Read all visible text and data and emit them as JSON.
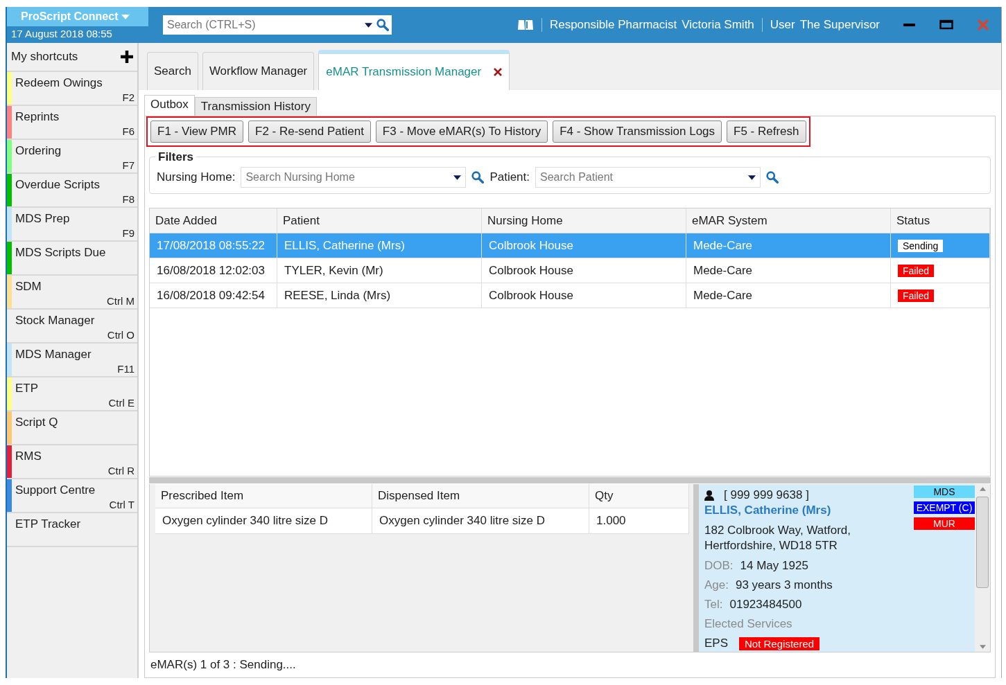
{
  "app": {
    "title": "ProScript Connect",
    "datetime": "17 August 2018 08:55",
    "search_placeholder": "Search (CTRL+S)",
    "pharmacist_label": "Responsible Pharmacist",
    "pharmacist": "Victoria Smith",
    "user_label": "User",
    "user": "The Supervisor"
  },
  "sidebar": {
    "title": "My shortcuts",
    "items": [
      {
        "label": "Redeem Owings",
        "shortcut": "F2",
        "color": "#ffff80"
      },
      {
        "label": "Reprints",
        "shortcut": "F6",
        "color": "#ff8080"
      },
      {
        "label": "Ordering",
        "shortcut": "F7",
        "color": "#80ff80"
      },
      {
        "label": "Overdue Scripts",
        "shortcut": "F8",
        "color": "#00c000"
      },
      {
        "label": "MDS Prep",
        "shortcut": "F9",
        "color": "#c0e4f8"
      },
      {
        "label": "MDS Scripts Due",
        "color": "#00c000"
      },
      {
        "label": "SDM",
        "shortcut": "Ctrl M",
        "color": "#ffe090"
      },
      {
        "label": "Stock Manager",
        "shortcut": "Ctrl O"
      },
      {
        "label": "MDS Manager",
        "shortcut": "F11",
        "color": "#c0e4f8"
      },
      {
        "label": "ETP",
        "shortcut": "Ctrl E",
        "color": "#ffff80"
      },
      {
        "label": "Script Q",
        "color": "#ffc870"
      },
      {
        "label": "RMS",
        "shortcut": "Ctrl R",
        "color": "#e0203c"
      },
      {
        "label": "Support Centre",
        "shortcut": "Ctrl T",
        "color": "#3a8ae0"
      },
      {
        "label": "ETP Tracker"
      }
    ]
  },
  "tabs": [
    {
      "label": "Search",
      "selected": false,
      "closable": false
    },
    {
      "label": "Workflow Manager",
      "selected": false,
      "closable": false
    },
    {
      "label": "eMAR Transmission Manager",
      "selected": true,
      "closable": true
    }
  ],
  "subtabs": [
    {
      "label": "Outbox",
      "selected": true
    },
    {
      "label": "Transmission History",
      "selected": false
    }
  ],
  "toolbar": [
    "F1 - View PMR",
    "F2 - Re-send Patient",
    "F3 - Move eMAR(s) To History",
    "F4 - Show Transmission Logs",
    "F5 - Refresh"
  ],
  "filters": {
    "title": "Filters",
    "nursing_home_label": "Nursing Home:",
    "nursing_home_placeholder": "Search Nursing Home",
    "patient_label": "Patient:",
    "patient_placeholder": "Search Patient"
  },
  "table": {
    "columns": [
      "Date Added",
      "Patient",
      "Nursing Home",
      "eMAR System",
      "Status"
    ],
    "rows": [
      {
        "date": "17/08/2018 08:55:22",
        "patient": "ELLIS, Catherine (Mrs)",
        "home": "Colbrook House",
        "system": "Mede-Care",
        "status": "Sending",
        "color": "#ffffff",
        "selected": true
      },
      {
        "date": "16/08/2018 12:02:03",
        "patient": "TYLER, Kevin (Mr)",
        "home": "Colbrook House",
        "system": "Mede-Care",
        "status": "Failed",
        "color": "#ff0000",
        "selected": false
      },
      {
        "date": "16/08/2018 09:42:54",
        "patient": "REESE, Linda (Mrs)",
        "home": "Colbrook House",
        "system": "Mede-Care",
        "status": "Failed",
        "color": "#ff0000",
        "selected": false
      }
    ]
  },
  "items_table": {
    "columns": [
      "Prescribed Item",
      "Dispensed Item",
      "Qty"
    ],
    "rows": [
      [
        "Oxygen cylinder 340 litre size D",
        "Oxygen cylinder 340 litre size D",
        "1.000"
      ]
    ]
  },
  "patient_card": {
    "nhs": "[ 999 999 9638 ]",
    "name": "ELLIS, Catherine (Mrs)",
    "address": [
      "182 Colbrook Way, Watford,",
      "Hertfordshire, WD18 5TR"
    ],
    "fields": [
      {
        "label": "DOB:",
        "value": "14 May 1925"
      },
      {
        "label": "Age:",
        "value": "93 years 3 months"
      },
      {
        "label": "Tel:",
        "value": "01923484500"
      }
    ],
    "flags": [
      {
        "label": "MDS",
        "color": "#66d8fb"
      },
      {
        "label": "EXEMPT (C)",
        "color": "#0000ff"
      },
      {
        "label": "MUR",
        "color": "#ff0000"
      }
    ],
    "services_title": "Elected Services",
    "service": "EPS",
    "service_status": "Not Registered"
  },
  "status_bar": "eMAR(s) 1 of 3 : Sending...."
}
